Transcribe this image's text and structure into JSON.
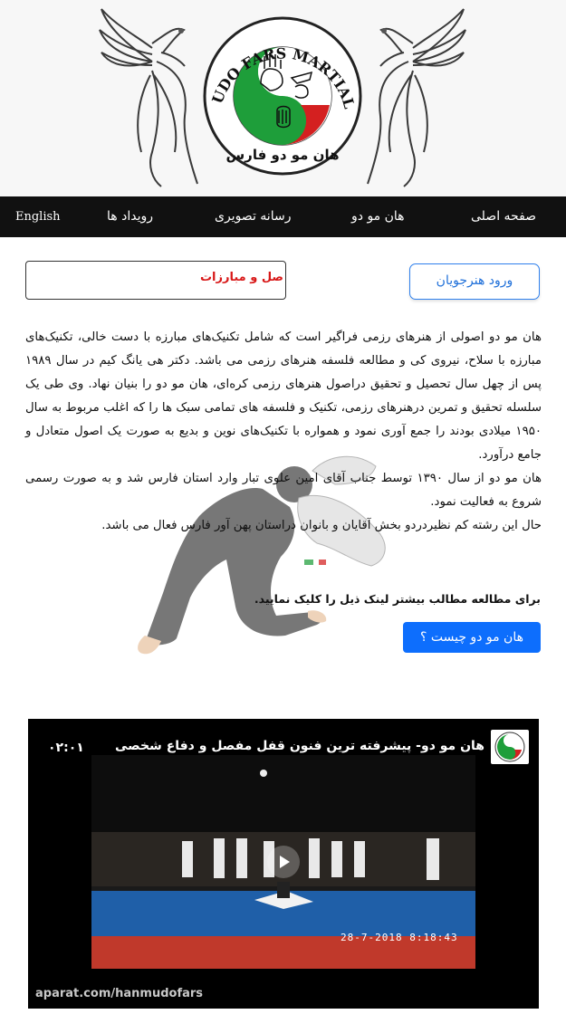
{
  "logo": {
    "text_top": "HANMUDO FARS MARTIAL ARTS",
    "text_bottom": "هان مو دو فارس"
  },
  "nav": {
    "items": [
      {
        "label": "صفحه اصلی"
      },
      {
        "label": "هان مو دو"
      },
      {
        "label": "رسانه تصویری"
      },
      {
        "label": "رویداد ها"
      },
      {
        "label": "English"
      }
    ]
  },
  "main": {
    "login_button": "ورود هنرجویان",
    "marquee": "صل و مبارزات",
    "paragraphs": [
      "هان مو دو اصولی از هنرهای رزمی فراگیر است که شامل تکنیک‌های مبارزه با دست خالی، تکنیک‌های مبارزه با سلاح، نیروی کی و مطالعه فلسفه هنرهای رزمی می باشد. دکتر هی یانگ کیم در سال ۱۹۸۹ پس از چهل سال تحصیل و تحقیق دراصول هنرهای رزمی کره‌ای، هان مو دو را بنیان نهاد. وی طی یک سلسله تحقیق و تمرین درهنرهای رزمی، تکنیک و فلسفه های تمامی سبک ها را که اغلب مربوط به سال ۱۹۵۰ میلادی بودند را جمع آوری نمود و همواره با تکنیک‌های نوین و بدیع به صورت یک اصول متعادل و جامع درآورد.",
      "هان مو دو از سال ۱۳۹۰ توسط جناب آقای امین علوی تبار وارد استان فارس شد و به صورت رسمی شروع به فعالیت نمود.",
      "حال این رشته کم نظیردردو بخش آقایان و بانوان دراستان پهن آور فارس فعال می باشد."
    ],
    "more_note": "برای مطالعه مطالب بیشتر لینک ذیل را کلیک نمایید.",
    "what_button": "هان مو دو چیست ؟"
  },
  "video": {
    "title": "هان مو دو- پیشرفته ترین فنون قفل مفصل و دفاع شخصی",
    "duration": "۰۲:۰۱",
    "timestamp": "28-7-2018   8:18:43",
    "source": "aparat.com/hanmudofars"
  },
  "colors": {
    "nav_bg": "#111111",
    "accent_blue": "#0d6efd",
    "marquee_red": "#d81818",
    "logo_green": "#1e9e3a",
    "logo_red": "#d42020"
  }
}
